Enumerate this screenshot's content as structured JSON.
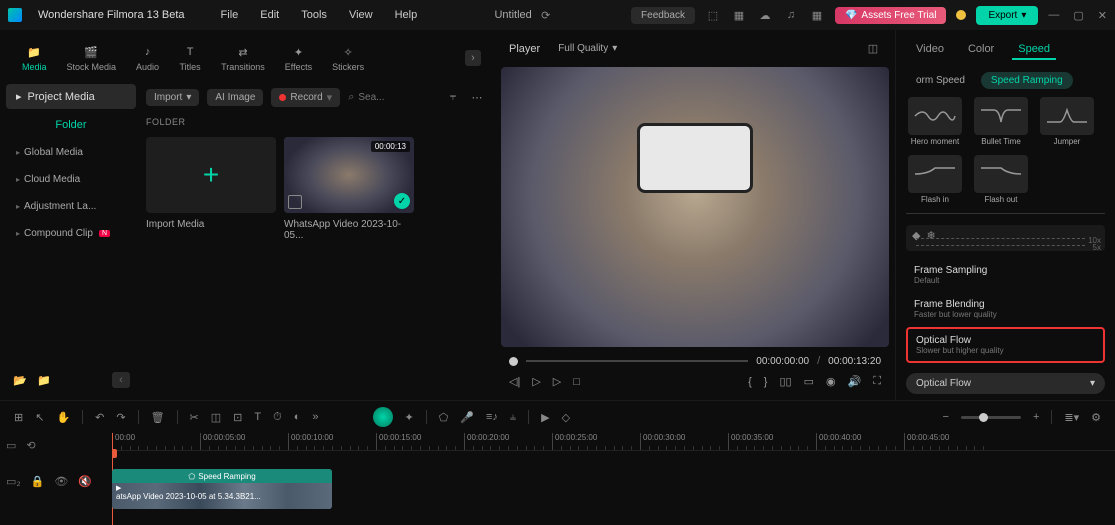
{
  "app": {
    "title": "Wondershare Filmora 13 Beta",
    "project": "Untitled"
  },
  "menus": [
    "File",
    "Edit",
    "Tools",
    "View",
    "Help"
  ],
  "topButtons": {
    "feedback": "Feedback",
    "assets": "Assets Free Trial",
    "export": "Export"
  },
  "mediaTabs": [
    {
      "label": "Media",
      "active": true
    },
    {
      "label": "Stock Media"
    },
    {
      "label": "Audio"
    },
    {
      "label": "Titles"
    },
    {
      "label": "Transitions"
    },
    {
      "label": "Effects"
    },
    {
      "label": "Stickers"
    }
  ],
  "sidebar": {
    "project": "Project Media",
    "folder": "Folder",
    "items": [
      {
        "label": "Global Media"
      },
      {
        "label": "Cloud Media"
      },
      {
        "label": "Adjustment La..."
      },
      {
        "label": "Compound Clip",
        "new": true
      }
    ]
  },
  "toolbar2": {
    "import": "Import",
    "ai": "AI Image",
    "record": "Record",
    "searchPlaceholder": "Sea..."
  },
  "folderLabel": "FOLDER",
  "thumbs": {
    "import": "Import Media",
    "clip": {
      "name": "WhatsApp Video 2023-10-05...",
      "duration": "00:00:13"
    }
  },
  "player": {
    "label": "Player",
    "quality": "Full Quality",
    "current": "00:00:00:00",
    "total": "00:00:13:20"
  },
  "rightPanel": {
    "tabs": [
      "Video",
      "Color",
      "Speed"
    ],
    "subTabs": {
      "uniform": "orm Speed",
      "ramping": "Speed Ramping"
    },
    "presets": [
      {
        "label": "Hero moment"
      },
      {
        "label": "Bullet Time"
      },
      {
        "label": "Jumper"
      },
      {
        "label": "Flash in"
      },
      {
        "label": "Flash out"
      }
    ],
    "graphLabels": {
      "top": "10x",
      "bottom": "5x"
    },
    "options": [
      {
        "title": "Frame Sampling",
        "sub": "Default"
      },
      {
        "title": "Frame Blending",
        "sub": "Faster but lower quality"
      },
      {
        "title": "Optical Flow",
        "sub": "Slower but higher quality",
        "highlight": true
      }
    ],
    "dropdown": "Optical Flow"
  },
  "timeline": {
    "ticks": [
      "00:00",
      "00:00:05:00",
      "00:00:10:00",
      "00:00:15:00",
      "00:00:20:00",
      "00:00:25:00",
      "00:00:30:00",
      "00:00:35:00",
      "00:00:40:00",
      "00:00:45:00"
    ],
    "clipLabel": "Speed Ramping",
    "clipText": "atsApp Video 2023-10-05 at 5.34.3B21..."
  }
}
